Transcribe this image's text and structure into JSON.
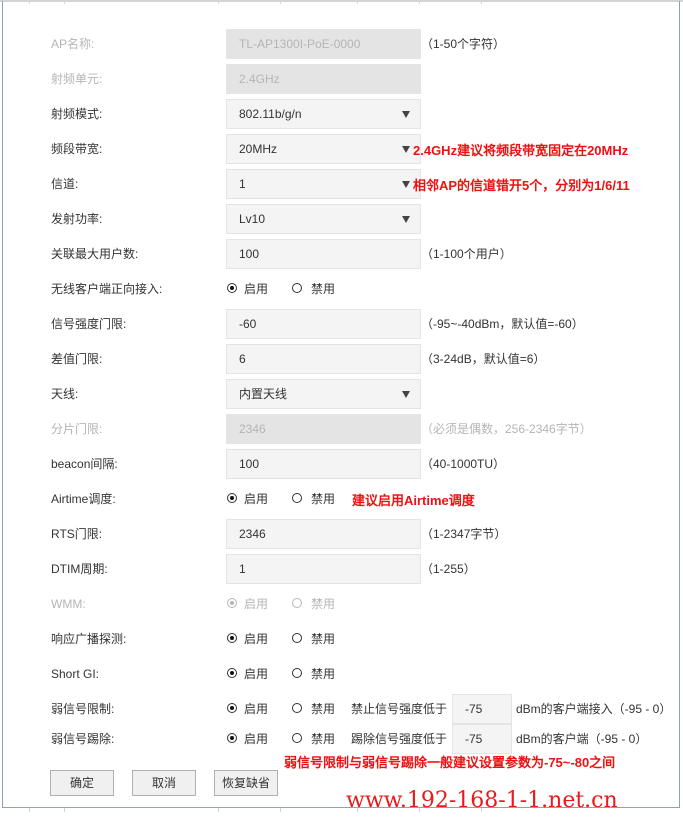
{
  "form": {
    "ap_name": {
      "label": "AP名称:",
      "value": "TL-AP1300I-PoE-0000",
      "hint": "（1-50个字符）",
      "disabled": true
    },
    "radio_unit": {
      "label": "射频单元:",
      "value": "2.4GHz",
      "disabled": true
    },
    "radio_mode": {
      "label": "射频模式:",
      "value": "802.11b/g/n"
    },
    "bandwidth": {
      "label": "频段带宽:",
      "value": "20MHz",
      "note": "2.4GHz建议将频段带宽固定在20MHz"
    },
    "channel": {
      "label": "信道:",
      "value": "1",
      "note": "相邻AP的信道错开5个，分别为1/6/11"
    },
    "tx_power": {
      "label": "发射功率:",
      "value": "Lv10"
    },
    "max_users": {
      "label": "关联最大用户数:",
      "value": "100",
      "hint": "（1-100个用户）"
    },
    "band_steering": {
      "label": "无线客户端正向接入:",
      "enable": "启用",
      "disable": "禁用",
      "selected": "enable"
    },
    "signal_threshold": {
      "label": "信号强度门限:",
      "value": "-60",
      "hint": "（-95~-40dBm，默认值=-60）"
    },
    "diff_threshold": {
      "label": "差值门限:",
      "value": "6",
      "hint": "（3-24dB，默认值=6）"
    },
    "antenna": {
      "label": "天线:",
      "value": "内置天线"
    },
    "frag_threshold": {
      "label": "分片门限:",
      "value": "2346",
      "hint": "（必须是偶数，256-2346字节）",
      "disabled": true
    },
    "beacon_interval": {
      "label": "beacon间隔:",
      "value": "100",
      "hint": "（40-1000TU）"
    },
    "airtime": {
      "label": "Airtime调度:",
      "enable": "启用",
      "disable": "禁用",
      "selected": "enable",
      "note": "建议启用Airtime调度"
    },
    "rts_threshold": {
      "label": "RTS门限:",
      "value": "2346",
      "hint": "（1-2347字节）"
    },
    "dtim_period": {
      "label": "DTIM周期:",
      "value": "1",
      "hint": "（1-255）"
    },
    "wmm": {
      "label": "WMM:",
      "enable": "启用",
      "disable": "禁用",
      "selected": "enable",
      "disabled": true
    },
    "broadcast_probe": {
      "label": "响应广播探测:",
      "enable": "启用",
      "disable": "禁用",
      "selected": "enable"
    },
    "short_gi": {
      "label": "Short GI:",
      "enable": "启用",
      "disable": "禁用",
      "selected": "enable"
    },
    "weak_limit": {
      "label": "弱信号限制:",
      "enable": "启用",
      "disable": "禁用",
      "selected": "enable",
      "prefix": "禁止信号强度低于",
      "value": "-75",
      "suffix": "dBm的客户端接入（-95 - 0）"
    },
    "weak_kick": {
      "label": "弱信号踢除:",
      "enable": "启用",
      "disable": "禁用",
      "selected": "enable",
      "prefix": "踢除信号强度低于",
      "value": "-75",
      "suffix": "dBm的客户端（-95 - 0）"
    },
    "weak_note": "弱信号限制与弱信号踢除一般建议设置参数为-75~-80之间"
  },
  "buttons": {
    "ok": "确定",
    "cancel": "取消",
    "restore": "恢复缺省"
  },
  "watermark": "www.192-168-1-1.net.cn",
  "colors": {
    "note": "#ee1111",
    "border": "#8aa3b8"
  }
}
